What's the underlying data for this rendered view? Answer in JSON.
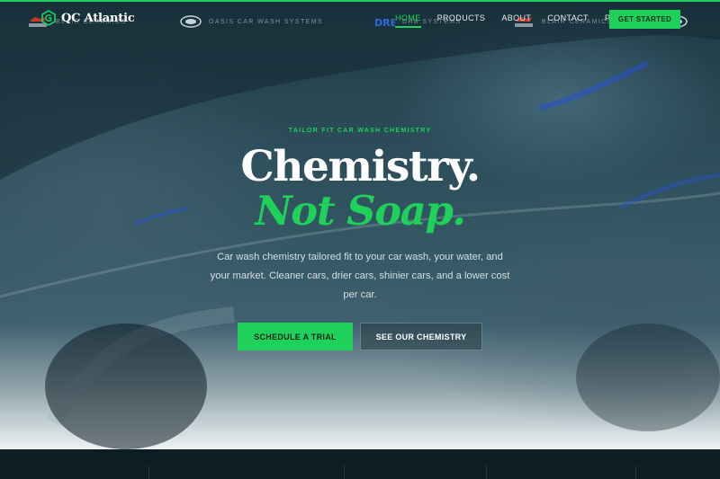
{
  "brand": {
    "name": "QC Atlantic",
    "accent": "#1fd05a"
  },
  "nav": {
    "items": [
      {
        "label": "HOME",
        "active": true
      },
      {
        "label": "PRODUCTS",
        "active": false
      },
      {
        "label": "ABOUT",
        "active": false
      },
      {
        "label": "CONTACT",
        "active": false
      },
      {
        "label": "PAY",
        "active": false
      }
    ],
    "cta": "GET STARTED"
  },
  "hero": {
    "eyebrow": "TAILOR FIT CAR WASH CHEMISTRY",
    "headline": "Chemistry.",
    "headline_accent": "Not Soap.",
    "description": "Car wash chemistry tailored fit to your car wash, your water, and your market. Cleaner cars, drier cars, shinier cars, and a lower cost per car.",
    "primary_button": "SCHEDULE A TRIAL",
    "secondary_button": "SEE OUR CHEMISTRY"
  },
  "partners": [
    {
      "name": "BLAIR CERAMICS",
      "logo": "blair-logo"
    },
    {
      "name": "OASIS CAR WASH SYSTEMS",
      "logo": "oasis-logo"
    },
    {
      "name": "DRB SYSTEMS",
      "logo": "drb-logo"
    },
    {
      "name": "BLAIR CERAMICS",
      "logo": "blair-logo"
    },
    {
      "name": "",
      "logo": "oasis-logo"
    }
  ]
}
